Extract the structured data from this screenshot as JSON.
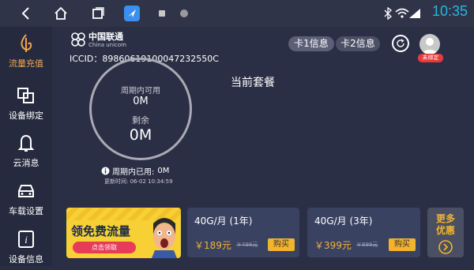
{
  "status_bar": {
    "time": "10:35",
    "back_icon": "back-icon",
    "home_icon": "home-icon",
    "recents_icon": "recents-icon",
    "app_icon": "navigation-app-icon"
  },
  "sidebar": {
    "items": [
      {
        "label": "流量充值",
        "icon": "data-topup-icon",
        "active": true
      },
      {
        "label": "设备绑定",
        "icon": "device-bind-icon"
      },
      {
        "label": "云消息",
        "icon": "bell-icon"
      },
      {
        "label": "车载设置",
        "icon": "car-icon"
      },
      {
        "label": "设备信息",
        "icon": "info-icon"
      }
    ]
  },
  "header": {
    "carrier_name": "中国联通",
    "carrier_en": "China unicom",
    "iccid_label": "ICCID：",
    "iccid": "89860619100047232550C",
    "card1_label": "卡1信息",
    "card2_label": "卡2信息",
    "unbound_label": "未绑定"
  },
  "plan": {
    "current_plan_title": "当前套餐",
    "available_label": "周期内可用",
    "available_value": "0M",
    "remaining_label": "剩余",
    "remaining_value": "0M",
    "used_label": "周期内已用:",
    "used_value": "0M",
    "update_time": "更新时间: 06-02 10:34:59"
  },
  "promo": {
    "headline": "领免费流量",
    "button_label": "点击领取"
  },
  "cards": [
    {
      "title": "40G/月",
      "duration": "(1年)",
      "price": "￥189元",
      "original_price": "￥498元",
      "buy_label": "购买"
    },
    {
      "title": "40G/月",
      "duration": "(3年)",
      "price": "￥399元",
      "original_price": "￥899元",
      "buy_label": "购买"
    }
  ],
  "more": {
    "line1": "更多",
    "line2": "优惠"
  }
}
